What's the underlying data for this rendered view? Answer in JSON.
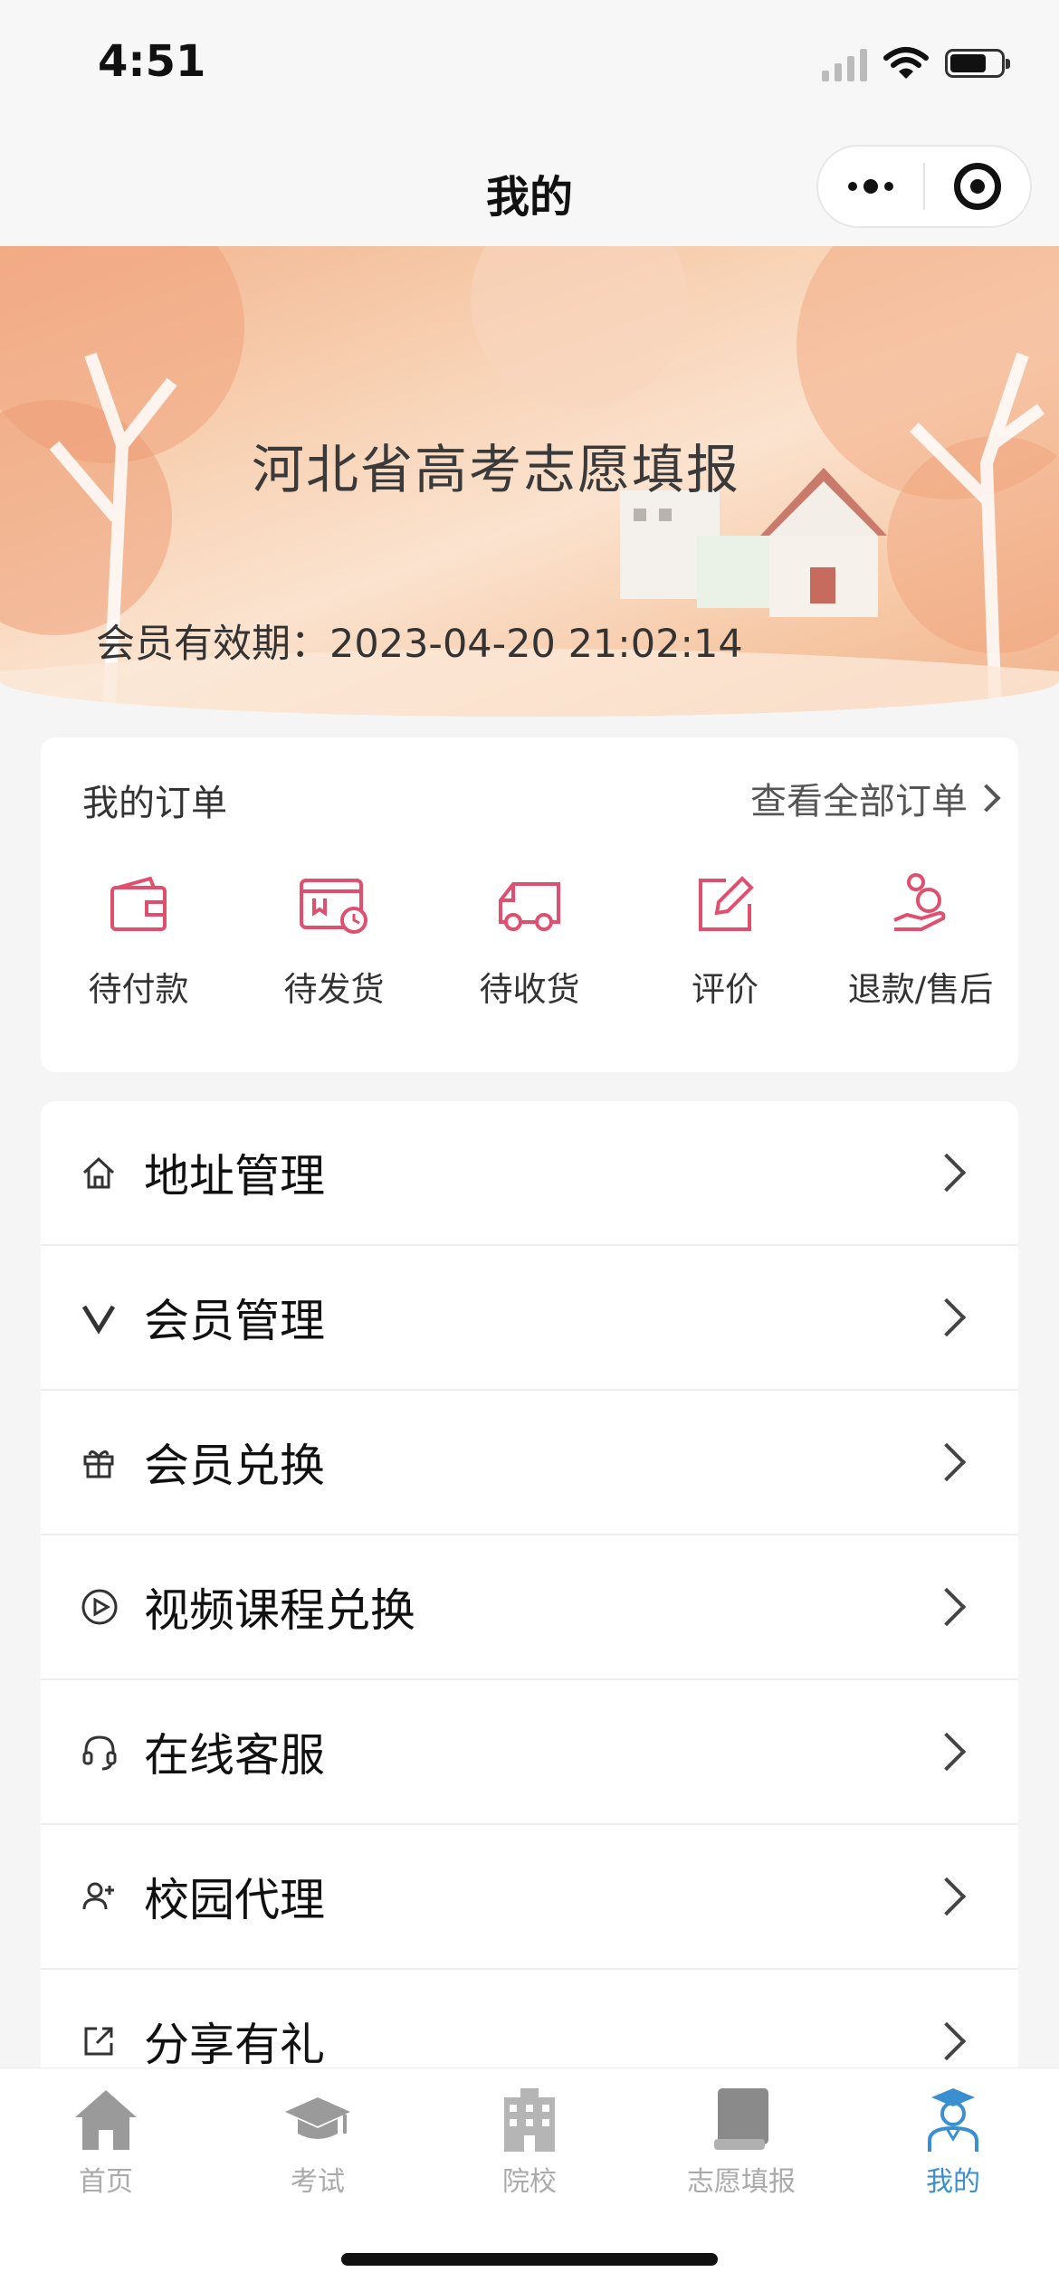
{
  "status_bar": {
    "time": "4:51"
  },
  "nav": {
    "title": "我的"
  },
  "banner": {
    "title": "河北省高考志愿填报",
    "expiry": "会员有效期：2023-04-20 21:02:14"
  },
  "orders": {
    "title": "我的订单",
    "view_all": "查看全部订单",
    "items": [
      {
        "label": "待付款",
        "icon": "wallet-icon"
      },
      {
        "label": "待发货",
        "icon": "package-clock-icon"
      },
      {
        "label": "待收货",
        "icon": "truck-icon"
      },
      {
        "label": "评价",
        "icon": "edit-icon"
      },
      {
        "label": "退款/售后",
        "icon": "refund-hand-icon"
      }
    ],
    "accent_color": "#e0506e"
  },
  "menu": {
    "items": [
      {
        "label": "地址管理",
        "icon": "home-outline-icon"
      },
      {
        "label": "会员管理",
        "icon": "v-icon"
      },
      {
        "label": "会员兑换",
        "icon": "gift-icon"
      },
      {
        "label": "视频课程兑换",
        "icon": "play-circle-icon"
      },
      {
        "label": "在线客服",
        "icon": "headset-icon"
      },
      {
        "label": "校园代理",
        "icon": "user-plus-icon"
      },
      {
        "label": "分享有礼",
        "icon": "share-icon"
      }
    ]
  },
  "tabbar": {
    "items": [
      {
        "label": "首页",
        "icon": "home-icon"
      },
      {
        "label": "考试",
        "icon": "graduation-cap-icon"
      },
      {
        "label": "院校",
        "icon": "building-icon"
      },
      {
        "label": "志愿填报",
        "icon": "book-icon"
      },
      {
        "label": "我的",
        "icon": "student-icon"
      }
    ],
    "active_index": 4,
    "active_color": "#3a8fd0",
    "inactive_color": "#aaaaaa"
  }
}
